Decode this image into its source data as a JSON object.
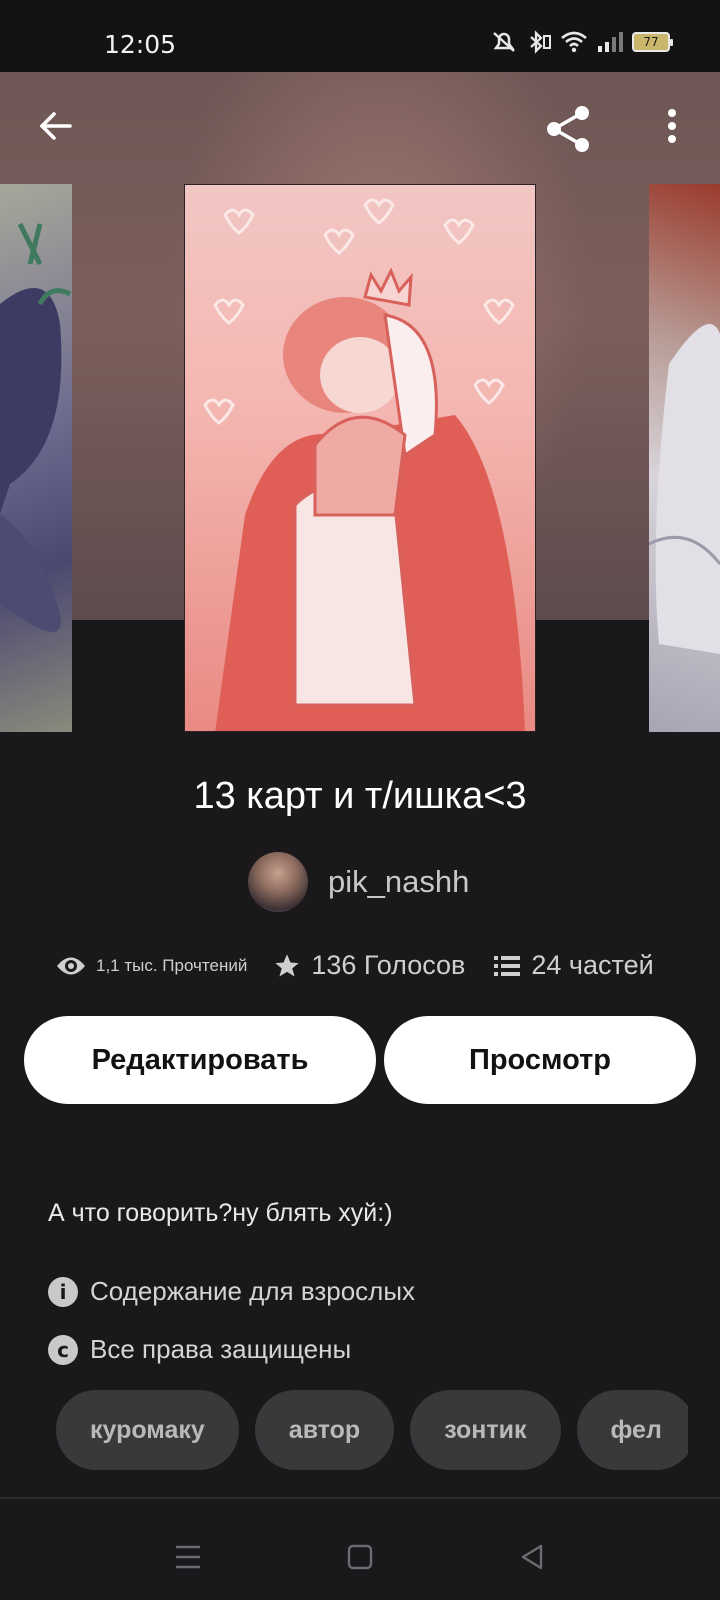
{
  "status_bar": {
    "time": "12:05",
    "battery": "77"
  },
  "story": {
    "title": "13 карт и т/ишка<3",
    "author": "pik_nashh",
    "reads": "1,1 тыс. Прочтений",
    "votes": "136 Голосов",
    "parts": "24 частей",
    "description": "А что говорить?ну блять хуй:)",
    "mature_label": "Содержание для взрослых",
    "copyright_label": "Все права защищены"
  },
  "buttons": {
    "edit": "Редактировать",
    "view": "Просмотр"
  },
  "tags": [
    "куромаку",
    "автор",
    "зонтик",
    "фел"
  ],
  "icons": {
    "back": "arrow-left-icon",
    "share": "share-icon",
    "more": "more-vert-icon",
    "reads": "eye-icon",
    "votes": "star-icon",
    "parts": "list-icon",
    "mature": "info-icon",
    "copyright": "copyright-icon"
  },
  "colors": {
    "background": "#1a181b",
    "button_bg": "#ffffff",
    "tag_bg": "#3a383b",
    "cover_pink": "#f4b7b2"
  }
}
